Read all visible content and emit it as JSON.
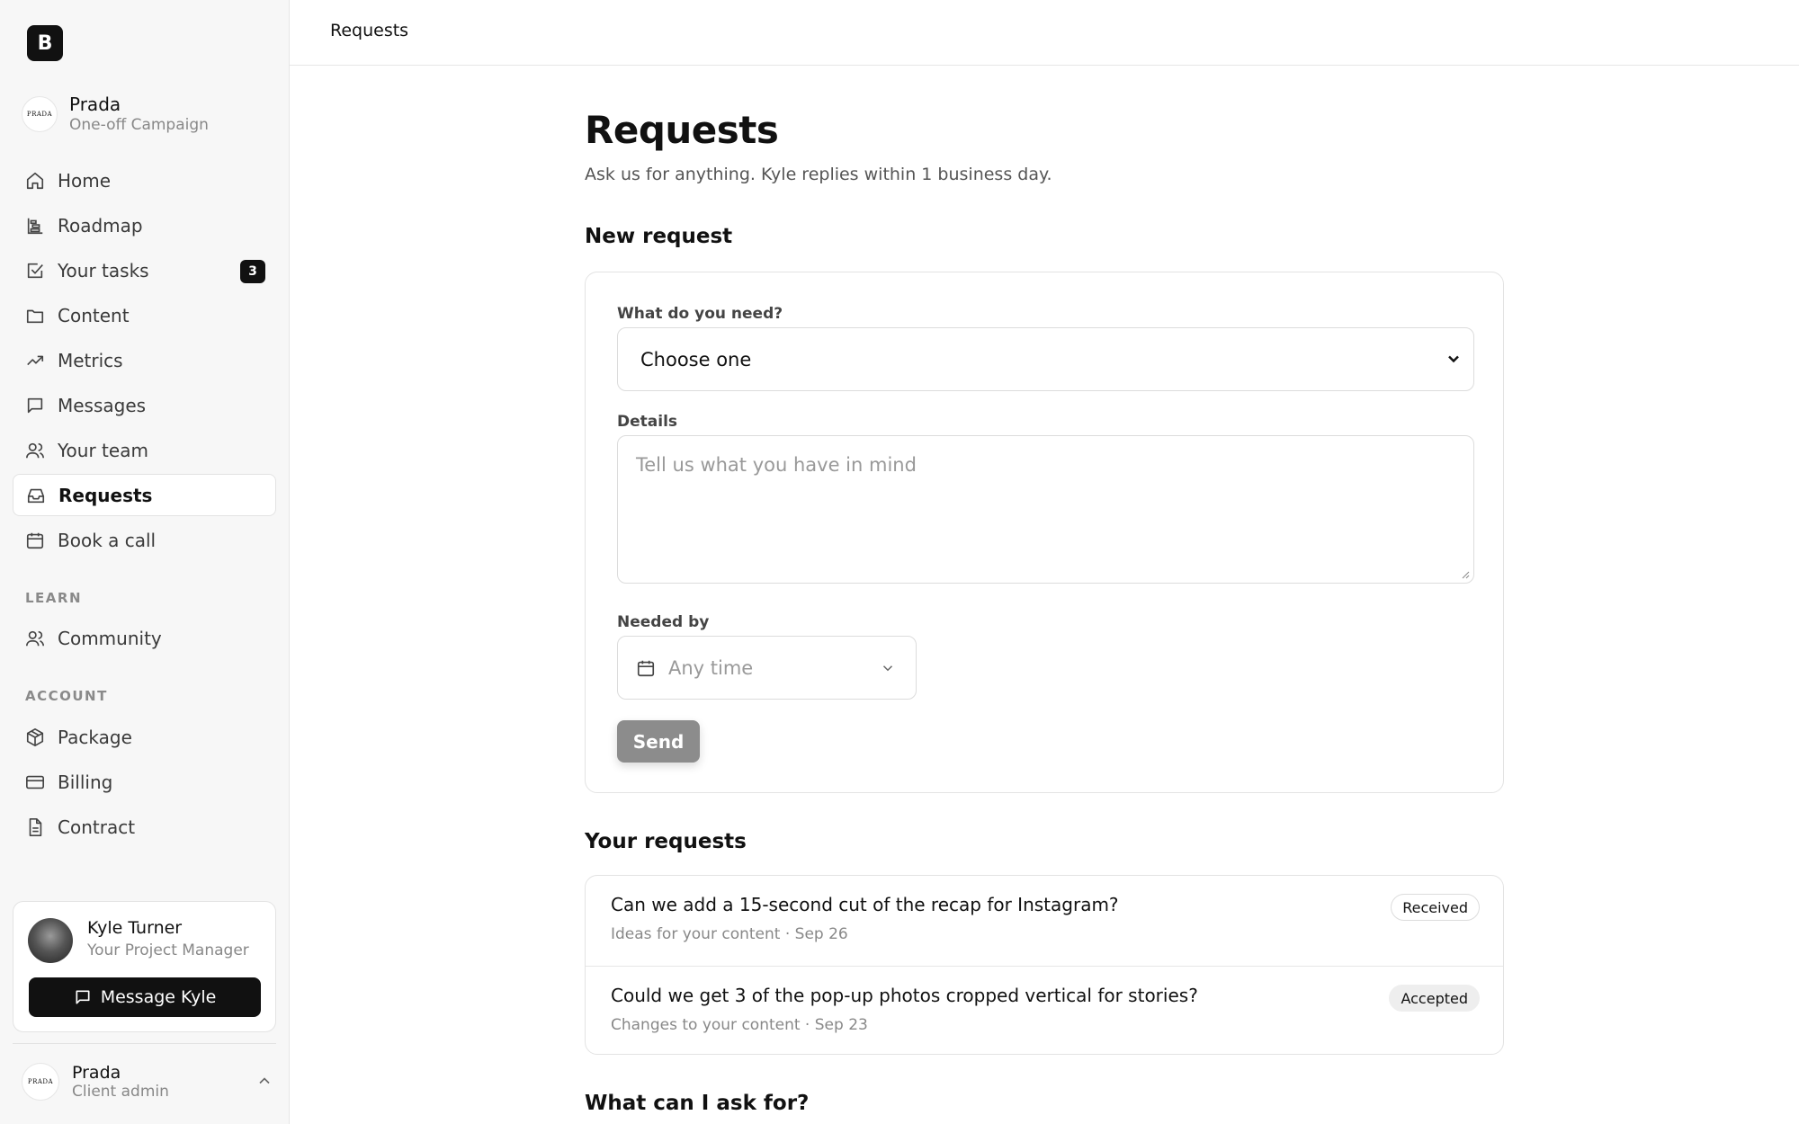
{
  "sidebar": {
    "logo_letter": "B",
    "brand": {
      "logo_text": "PRADA",
      "name": "Prada",
      "subtitle": "One-off Campaign"
    },
    "nav": [
      {
        "label": "Home",
        "icon": "home-icon"
      },
      {
        "label": "Roadmap",
        "icon": "roadmap-icon"
      },
      {
        "label": "Your tasks",
        "icon": "checkbox-icon",
        "badge": "3"
      },
      {
        "label": "Content",
        "icon": "folder-icon"
      },
      {
        "label": "Metrics",
        "icon": "trending-up-icon"
      },
      {
        "label": "Messages",
        "icon": "message-icon"
      },
      {
        "label": "Your team",
        "icon": "users-icon"
      },
      {
        "label": "Requests",
        "icon": "inbox-icon",
        "active": true
      },
      {
        "label": "Book a call",
        "icon": "calendar-icon"
      }
    ],
    "learn_label": "LEARN",
    "learn": [
      {
        "label": "Community",
        "icon": "users-icon"
      }
    ],
    "account_label": "ACCOUNT",
    "account_items": [
      {
        "label": "Package",
        "icon": "package-icon"
      },
      {
        "label": "Billing",
        "icon": "credit-card-icon"
      },
      {
        "label": "Contract",
        "icon": "file-icon"
      }
    ],
    "pm": {
      "name": "Kyle Turner",
      "role": "Your Project Manager",
      "button": "Message Kyle"
    },
    "account": {
      "logo_text": "PRADA",
      "name": "Prada",
      "role": "Client admin"
    }
  },
  "topbar": {
    "title": "Requests"
  },
  "main": {
    "title": "Requests",
    "subtitle": "Ask us for anything. Kyle replies within 1 business day.",
    "new_request_title": "New request",
    "form": {
      "need_label": "What do you need?",
      "need_value": "Choose one",
      "details_label": "Details",
      "details_placeholder": "Tell us what you have in mind",
      "needed_by_label": "Needed by",
      "needed_by_value": "Any time",
      "send_label": "Send"
    },
    "your_requests_title": "Your requests",
    "requests": [
      {
        "title": "Can we add a 15-second cut of the recap for Instagram?",
        "meta": "Ideas for your content · Sep 26",
        "status": "Received"
      },
      {
        "title": "Could we get 3 of the pop-up photos cropped vertical for stories?",
        "meta": "Changes to your content · Sep 23",
        "status": "Accepted"
      }
    ],
    "faq_title": "What can I ask for?"
  }
}
